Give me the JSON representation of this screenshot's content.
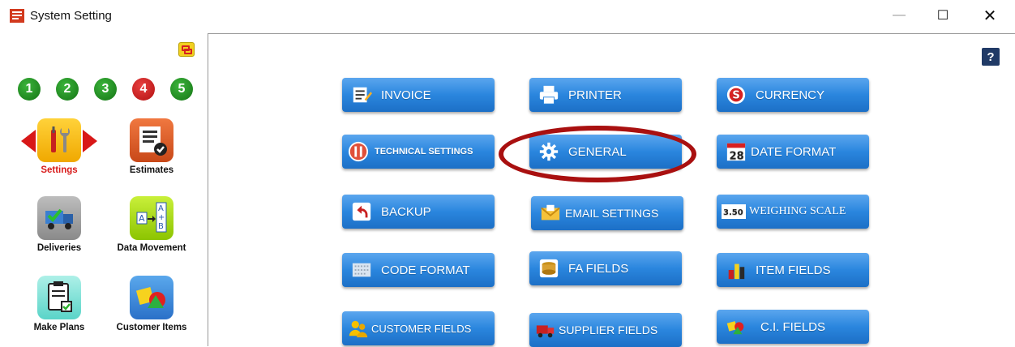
{
  "window": {
    "title": "System Setting",
    "minimize_glyph": "—",
    "maximize_glyph": "☐",
    "close_glyph": "✕"
  },
  "sidebar": {
    "steps": [
      "1",
      "2",
      "3",
      "4",
      "5"
    ],
    "step_colors": [
      "green",
      "green",
      "green",
      "red",
      "green"
    ],
    "modules": [
      {
        "label": "Settings",
        "icon": "tools-icon",
        "active": true
      },
      {
        "label": "Estimates",
        "icon": "document-check-icon",
        "active": false
      },
      {
        "label": "Deliveries",
        "icon": "delivery-truck-icon",
        "active": false
      },
      {
        "label": "Data Movement",
        "icon": "data-movement-icon",
        "active": false
      },
      {
        "label": "Make Plans",
        "icon": "clipboard-check-icon",
        "active": false
      },
      {
        "label": "Customer Items",
        "icon": "shapes-icon",
        "active": false
      }
    ]
  },
  "help": {
    "label": "?"
  },
  "buttons": [
    {
      "label": "INVOICE",
      "icon": "invoice-icon"
    },
    {
      "label": "PRINTER",
      "icon": "printer-icon"
    },
    {
      "label": "CURRENCY",
      "icon": "currency-icon"
    },
    {
      "label": "TECHNICAL SETTINGS",
      "icon": "technical-settings-icon"
    },
    {
      "label": "GENERAL",
      "icon": "gear-icon"
    },
    {
      "label": "DATE FORMAT",
      "icon": "calendar-icon",
      "calendar_day": "28"
    },
    {
      "label": "BACKUP",
      "icon": "backup-icon"
    },
    {
      "label": "EMAIL SETTINGS",
      "icon": "email-icon"
    },
    {
      "label": "WEIGHING SCALE",
      "icon": "scale-icon",
      "scale_value": "3.50"
    },
    {
      "label": "CODE FORMAT",
      "icon": "code-format-icon"
    },
    {
      "label": "FA FIELDS",
      "icon": "coins-icon"
    },
    {
      "label": "ITEM FIELDS",
      "icon": "item-fields-icon"
    },
    {
      "label": "CUSTOMER FIELDS",
      "icon": "customer-icon"
    },
    {
      "label": "SUPPLIER FIELDS",
      "icon": "supplier-truck-icon"
    },
    {
      "label": "C.I. FIELDS",
      "icon": "ci-shapes-icon"
    }
  ],
  "colors": {
    "button_blue": "#2a86de",
    "active_red": "#d81b1b",
    "highlight_red": "#a91010",
    "help_navy": "#203a66"
  }
}
